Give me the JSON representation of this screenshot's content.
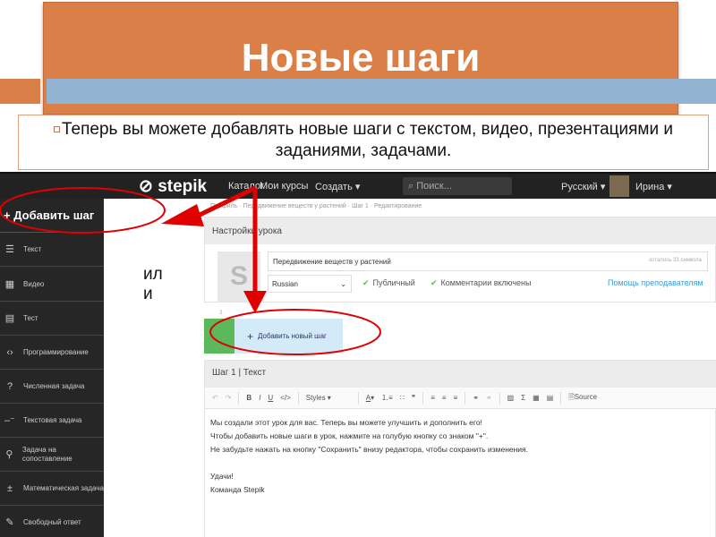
{
  "slide": {
    "title": "Новые шаги",
    "subtitle": "Теперь вы можете добавлять новые шаги с текстом, видео, презентациями и заданиями, задачами.",
    "or_label": "ил\nи"
  },
  "colors": {
    "title_bg": "#db7f48",
    "bar_blue": "#93b3d3",
    "annotation_red": "#e00000",
    "nav_bg": "#222222",
    "add_step_blue": "#d3ebf9",
    "green": "#5cb85c"
  },
  "topnav": {
    "logo": "stepik",
    "items": [
      "Каталог",
      "Мои курсы",
      "Создать"
    ],
    "search_placeholder": "Поиск...",
    "language": "Русский",
    "user": "Ирина"
  },
  "sidebar": {
    "add_step": "+ Добавить шаг",
    "items": [
      {
        "label": "Текст",
        "icon": "text-lines-icon"
      },
      {
        "label": "Видео",
        "icon": "video-icon"
      },
      {
        "label": "Тест",
        "icon": "test-icon"
      },
      {
        "label": "Программирование",
        "icon": "code-icon"
      },
      {
        "label": "Численная задача",
        "icon": "number-icon"
      },
      {
        "label": "Текстовая задача",
        "icon": "text-task-icon"
      },
      {
        "label": "Задача на сопоставление",
        "icon": "matching-icon"
      },
      {
        "label": "Математическая задача",
        "icon": "math-icon"
      },
      {
        "label": "Свободный ответ",
        "icon": "pencil-icon"
      }
    ]
  },
  "breadcrumb": [
    "Профиль",
    "Передвижение веществ у растений",
    "Шаг 1",
    "Редактирование"
  ],
  "settings": {
    "header": "Настройки урока",
    "title_value": "Передвижение веществ у растений",
    "chars_left": "осталось 33 символа",
    "language": "Russian",
    "public": "Публичный",
    "comments": "Комментарии включены",
    "help": "Помощь преподавателям"
  },
  "steps": {
    "number": "1",
    "add_new": "Добавить новый шаг"
  },
  "step": {
    "header": "Шаг 1 | Текст",
    "styles": "Styles",
    "source": "Source",
    "body": [
      "Мы создали этот урок для вас. Теперь вы можете улучшить и дополнить его!",
      "Чтобы добавить новые шаги в урок, нажмите на голубую кнопку со знаком \"+\".",
      "Не забудьте нажать на кнопку \"Сохранить\" внизу редактора, чтобы сохранить изменения.",
      "",
      "Удачи!",
      "Команда Stepik"
    ]
  }
}
